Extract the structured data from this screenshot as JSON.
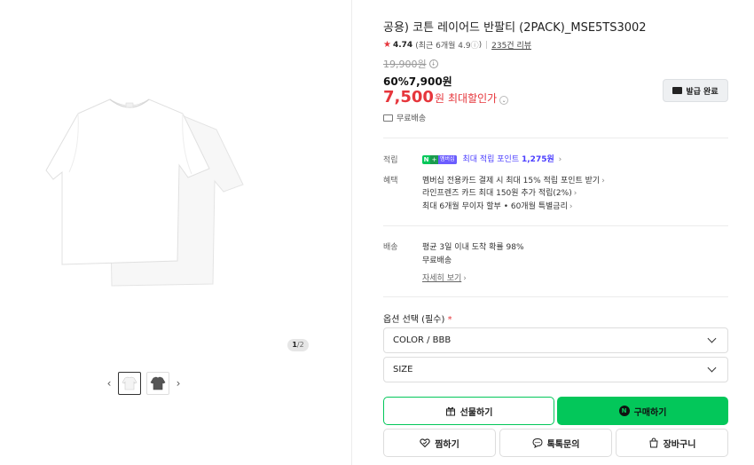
{
  "product": {
    "title": "공용) 코튼 레이어드 반팔티 (2PACK)_MSE5TS3002",
    "rating_score": "4.74",
    "rating_recent": "(최근 6개월 4.9",
    "rating_info_icon": "ⓘ",
    "rating_recent_close": ")",
    "review_count": "235건 리뷰",
    "original_price": "19,900원",
    "sale_line": "60%7,900원",
    "max_price_number": "7,500",
    "max_price_won": "원",
    "max_price_label": "최대할인가",
    "free_shipping": "무료배송",
    "coupon_button": "발급 완료"
  },
  "gallery": {
    "pager_current": "1",
    "pager_total": "/2",
    "prev_label": "‹",
    "next_label": "›"
  },
  "benefits": {
    "points_label": "적립",
    "npay_membership": "멤버십",
    "points_text": "최대 적립 포인트",
    "points_value": "1,275원",
    "benefit_label": "혜택",
    "benefit_items": [
      "멤버십 전용카드 결제 시 최대 15% 적립 포인트 받기",
      "라인프렌즈 카드 최대 150원 추가 적립(2%)",
      "최대 6개월 무이자 할부 • 60개월 특별금리"
    ]
  },
  "delivery": {
    "label": "배송",
    "line1": "평균 3일 이내 도착 확률 98%",
    "line2": "무료배송",
    "detail_link": "자세히 보기"
  },
  "options": {
    "title": "옵션 선택 (필수)",
    "required_mark": "*",
    "color_select": "COLOR / BBB",
    "size_select": "SIZE"
  },
  "actions": {
    "gift": "선물하기",
    "buy": "구매하기",
    "wish": "찜하기",
    "talk": "톡톡문의",
    "cart": "장바구니"
  },
  "colors": {
    "accent_red": "#e6363c",
    "npay_green": "#03c75a",
    "point_purple": "#4a3dff"
  }
}
